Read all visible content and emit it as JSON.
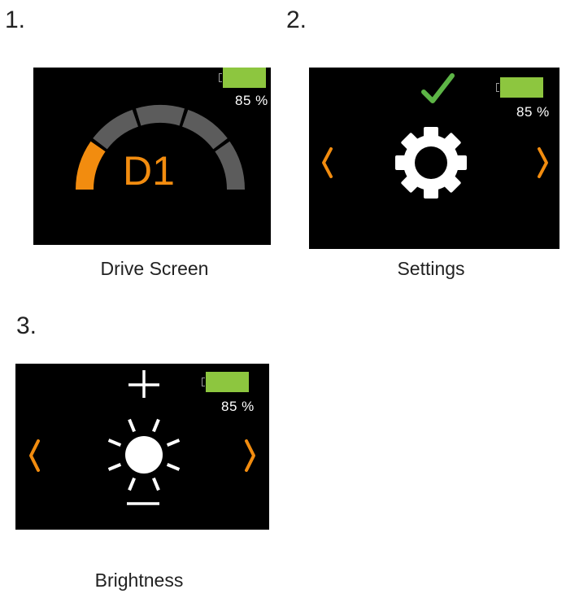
{
  "colors": {
    "accent": "#f28c0f",
    "battery": "#8dc63f",
    "check": "#5db546",
    "background": "#000000",
    "arc_off": "#5c5c5c"
  },
  "battery": {
    "level": 0.85,
    "label": "85 %"
  },
  "screens": [
    {
      "number": "1.",
      "caption": "Drive Screen",
      "drive_mode": "D1",
      "speed_segments_total": 5,
      "speed_segments_active": 1
    },
    {
      "number": "2.",
      "caption": "Settings",
      "icons": [
        "check-icon",
        "gear-icon",
        "chevron-left-icon",
        "chevron-right-icon"
      ]
    },
    {
      "number": "3.",
      "caption": "Brightness",
      "icons": [
        "plus-icon",
        "sun-icon",
        "minus-icon",
        "chevron-left-icon",
        "chevron-right-icon"
      ]
    }
  ]
}
